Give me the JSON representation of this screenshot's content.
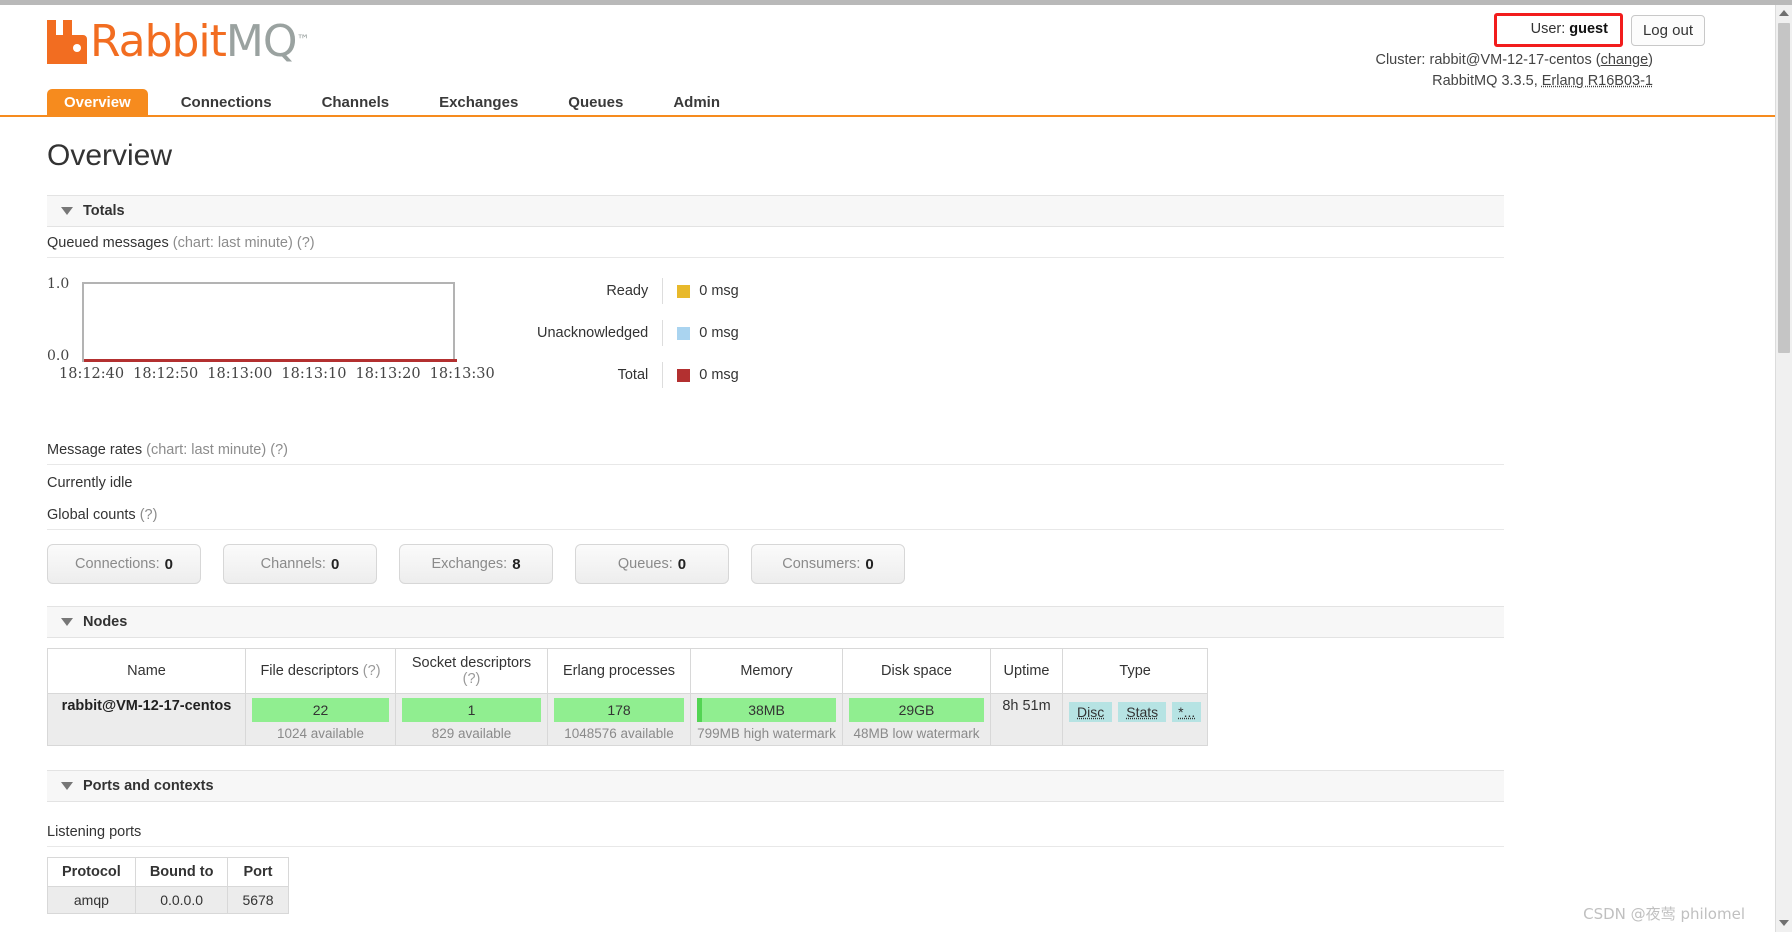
{
  "brand": {
    "name_part1": "Rabbit",
    "name_part2": "MQ",
    "tm": "™",
    "orange": "#f26d21",
    "grey": "#9aa2a0"
  },
  "header": {
    "user_label": "User:",
    "user_name": "guest",
    "logout_label": "Log out",
    "cluster_prefix": "Cluster:",
    "cluster_name": "rabbit@VM-12-17-centos",
    "cluster_change_open": "(",
    "cluster_change": "change",
    "cluster_change_close": ")",
    "version": "RabbitMQ 3.3.5,",
    "erlang": "Erlang R16B03-1",
    "highlight_color": "#f21c1c"
  },
  "nav": {
    "tabs": [
      {
        "label": "Overview",
        "active": true
      },
      {
        "label": "Connections",
        "active": false
      },
      {
        "label": "Channels",
        "active": false
      },
      {
        "label": "Exchanges",
        "active": false
      },
      {
        "label": "Queues",
        "active": false
      },
      {
        "label": "Admin",
        "active": false
      }
    ]
  },
  "page": {
    "title": "Overview"
  },
  "totals": {
    "section_label": "Totals",
    "queued_label": "Queued messages",
    "queued_note": "(chart: last minute)",
    "help": "(?)",
    "rates_label": "Message rates",
    "rates_note": "(chart: last minute)",
    "idle_text": "Currently idle",
    "global_counts_label": "Global counts"
  },
  "chart_data": {
    "type": "line",
    "title": "Queued messages (chart: last minute)",
    "xlabel": "",
    "ylabel": "",
    "ylim": [
      0.0,
      1.0
    ],
    "ytick_labels": [
      "1.0",
      "0.0"
    ],
    "x": [
      "18:12:40",
      "18:12:50",
      "18:13:00",
      "18:13:10",
      "18:13:20",
      "18:13:30"
    ],
    "grid": false,
    "legend_position": "right",
    "series": [
      {
        "name": "Ready",
        "color": "#e8b92b",
        "value": 0,
        "unit": "msg",
        "values": [
          0,
          0,
          0,
          0,
          0,
          0
        ]
      },
      {
        "name": "Unacknowledged",
        "color": "#aad4f0",
        "value": 0,
        "unit": "msg",
        "values": [
          0,
          0,
          0,
          0,
          0,
          0
        ]
      },
      {
        "name": "Total",
        "color": "#b33030",
        "value": 0,
        "unit": "msg",
        "values": [
          0,
          0,
          0,
          0,
          0,
          0
        ]
      }
    ],
    "legend_rows": [
      {
        "name": "Ready",
        "value": "0 msg",
        "color": "#e8b92b"
      },
      {
        "name": "Unacknowledged",
        "value": "0 msg",
        "color": "#aad4f0"
      },
      {
        "name": "Total",
        "value": "0 msg",
        "color": "#b33030"
      }
    ]
  },
  "global_counts": [
    {
      "label": "Connections:",
      "value": "0"
    },
    {
      "label": "Channels:",
      "value": "0"
    },
    {
      "label": "Exchanges:",
      "value": "8"
    },
    {
      "label": "Queues:",
      "value": "0"
    },
    {
      "label": "Consumers:",
      "value": "0"
    }
  ],
  "nodes": {
    "section_label": "Nodes",
    "columns": [
      {
        "label": "Name",
        "help": ""
      },
      {
        "label": "File descriptors",
        "help": "(?)"
      },
      {
        "label": "Socket descriptors",
        "help": "(?)"
      },
      {
        "label": "Erlang processes",
        "help": ""
      },
      {
        "label": "Memory",
        "help": ""
      },
      {
        "label": "Disk space",
        "help": ""
      },
      {
        "label": "Uptime",
        "help": ""
      },
      {
        "label": "Type",
        "help": ""
      }
    ],
    "row": {
      "name": "rabbit@VM-12-17-centos",
      "file_descriptors": {
        "value": "22",
        "note": "1024 available"
      },
      "socket_descriptors": {
        "value": "1",
        "note": "829 available"
      },
      "erlang_processes": {
        "value": "178",
        "note": "1048576 available"
      },
      "memory": {
        "value": "38MB",
        "note": "799MB high watermark"
      },
      "disk_space": {
        "value": "29GB",
        "note": "48MB low watermark"
      },
      "uptime": "8h 51m",
      "type_badges": [
        "Disc",
        "Stats",
        "*..."
      ]
    }
  },
  "ports": {
    "section_label": "Ports and contexts",
    "listening_label": "Listening ports",
    "columns": [
      "Protocol",
      "Bound to",
      "Port"
    ],
    "rows": [
      {
        "protocol": "amqp",
        "bound_to": "0.0.0.0",
        "port": "5678"
      }
    ]
  },
  "watermark": {
    "text": "CSDN @夜莺 philomel"
  }
}
